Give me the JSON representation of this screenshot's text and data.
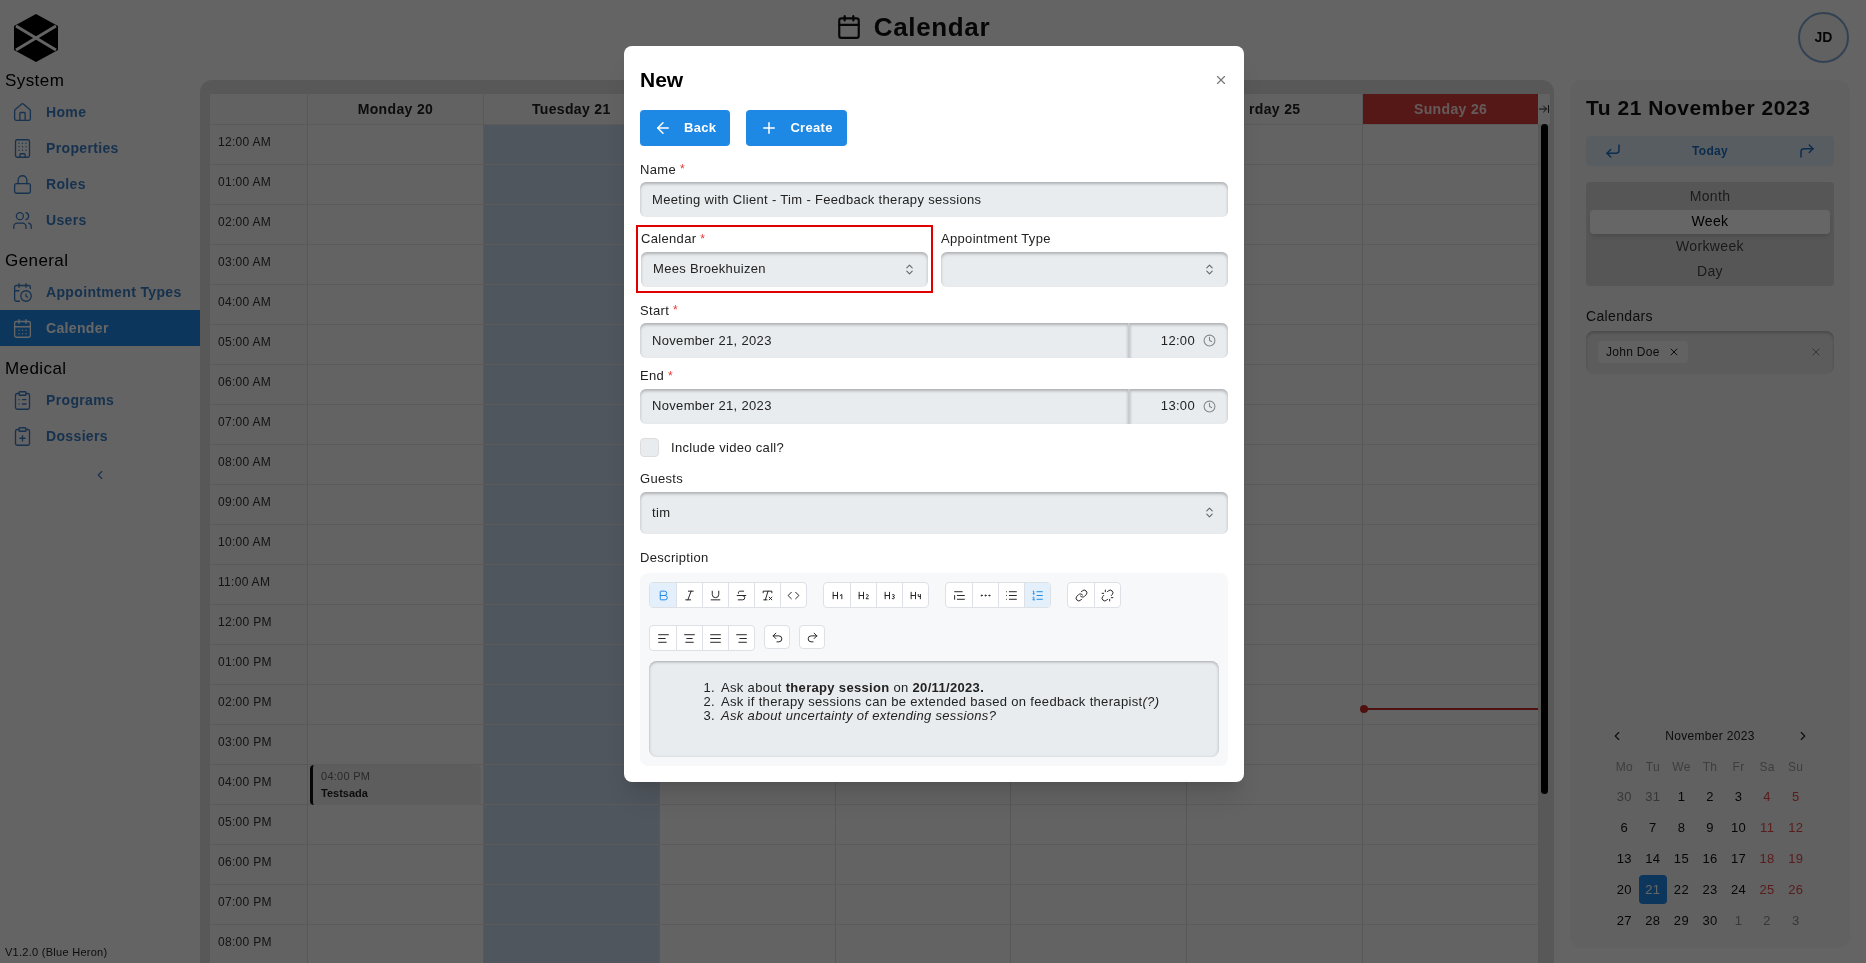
{
  "header": {
    "title": "Calendar",
    "avatar": "JD"
  },
  "sidebar": {
    "sections": [
      {
        "title": "System",
        "items": [
          {
            "label": "Home",
            "kind": "home",
            "selected": false
          },
          {
            "label": "Properties",
            "kind": "building",
            "selected": false
          },
          {
            "label": "Roles",
            "kind": "lock",
            "selected": false
          },
          {
            "label": "Users",
            "kind": "users",
            "selected": false
          }
        ]
      },
      {
        "title": "General",
        "items": [
          {
            "label": "Appointment Types",
            "kind": "calendar-clock",
            "selected": false
          },
          {
            "label": "Calender",
            "kind": "calendar",
            "selected": true
          }
        ]
      },
      {
        "title": "Medical",
        "items": [
          {
            "label": "Programs",
            "kind": "clipboard",
            "selected": false
          },
          {
            "label": "Dossiers",
            "kind": "clipboard-heart",
            "selected": false
          }
        ]
      }
    ],
    "version": "V1.2.0 (Blue Heron)"
  },
  "week": {
    "days": [
      {
        "label": "Monday 20",
        "today": false,
        "highlighted": false,
        "events": [
          {
            "time": "04:00 PM",
            "title": "Testsada"
          }
        ]
      },
      {
        "label": "Tuesday 21",
        "today": true,
        "highlighted": false
      },
      {
        "today": false
      },
      {
        "today": false
      },
      {
        "today": false
      },
      {
        "label": "rday 25",
        "today": false,
        "highlighted": false
      },
      {
        "label": "Sunday 26",
        "today": false,
        "highlighted": true
      }
    ],
    "hours": [
      "12:00 AM",
      "01:00 AM",
      "02:00 AM",
      "03:00 AM",
      "04:00 AM",
      "05:00 AM",
      "06:00 AM",
      "07:00 AM",
      "08:00 AM",
      "09:00 AM",
      "10:00 AM",
      "11:00 AM",
      "12:00 PM",
      "01:00 PM",
      "02:00 PM",
      "03:00 PM",
      "04:00 PM",
      "05:00 PM",
      "06:00 PM",
      "07:00 PM",
      "08:00 PM"
    ]
  },
  "right_panel": {
    "date_title": "Tu 21 November 2023",
    "today": "Today",
    "views": [
      {
        "label": "Month",
        "selected": false
      },
      {
        "label": "Week",
        "selected": true
      },
      {
        "label": "Workweek",
        "selected": false
      },
      {
        "label": "Day",
        "selected": false
      }
    ],
    "calendars_label": "Calendars",
    "chips": [
      "John Doe"
    ]
  },
  "mini_calendar": {
    "title": "November 2023",
    "weekdays": [
      "Mo",
      "Tu",
      "We",
      "Th",
      "Fr",
      "Sa",
      "Su"
    ],
    "weeks": [
      [
        {
          "label": "30",
          "outside": true,
          "weekend": false,
          "selected": false
        },
        {
          "label": "31",
          "outside": true,
          "weekend": false,
          "selected": false
        },
        {
          "label": "1",
          "outside": false,
          "weekend": false,
          "selected": false
        },
        {
          "label": "2",
          "outside": false,
          "weekend": false,
          "selected": false
        },
        {
          "label": "3",
          "outside": false,
          "weekend": false,
          "selected": false
        },
        {
          "label": "4",
          "outside": false,
          "weekend": true,
          "selected": false
        },
        {
          "label": "5",
          "outside": false,
          "weekend": true,
          "selected": false
        }
      ],
      [
        {
          "label": "6",
          "outside": false,
          "weekend": false,
          "selected": false
        },
        {
          "label": "7",
          "outside": false,
          "weekend": false,
          "selected": false
        },
        {
          "label": "8",
          "outside": false,
          "weekend": false,
          "selected": false
        },
        {
          "label": "9",
          "outside": false,
          "weekend": false,
          "selected": false
        },
        {
          "label": "10",
          "outside": false,
          "weekend": false,
          "selected": false
        },
        {
          "label": "11",
          "outside": false,
          "weekend": true,
          "selected": false
        },
        {
          "label": "12",
          "outside": false,
          "weekend": true,
          "selected": false
        }
      ],
      [
        {
          "label": "13",
          "outside": false,
          "weekend": false,
          "selected": false
        },
        {
          "label": "14",
          "outside": false,
          "weekend": false,
          "selected": false
        },
        {
          "label": "15",
          "outside": false,
          "weekend": false,
          "selected": false
        },
        {
          "label": "16",
          "outside": false,
          "weekend": false,
          "selected": false
        },
        {
          "label": "17",
          "outside": false,
          "weekend": false,
          "selected": false
        },
        {
          "label": "18",
          "outside": false,
          "weekend": true,
          "selected": false
        },
        {
          "label": "19",
          "outside": false,
          "weekend": true,
          "selected": false
        }
      ],
      [
        {
          "label": "20",
          "outside": false,
          "weekend": false,
          "selected": false
        },
        {
          "label": "21",
          "outside": false,
          "weekend": false,
          "selected": true
        },
        {
          "label": "22",
          "outside": false,
          "weekend": false,
          "selected": false
        },
        {
          "label": "23",
          "outside": false,
          "weekend": false,
          "selected": false
        },
        {
          "label": "24",
          "outside": false,
          "weekend": false,
          "selected": false
        },
        {
          "label": "25",
          "outside": false,
          "weekend": true,
          "selected": false
        },
        {
          "label": "26",
          "outside": false,
          "weekend": true,
          "selected": false
        }
      ],
      [
        {
          "label": "27",
          "outside": false,
          "weekend": false,
          "selected": false
        },
        {
          "label": "28",
          "outside": false,
          "weekend": false,
          "selected": false
        },
        {
          "label": "29",
          "outside": false,
          "weekend": false,
          "selected": false
        },
        {
          "label": "30",
          "outside": false,
          "weekend": false,
          "selected": false
        },
        {
          "label": "1",
          "outside": true,
          "weekend": false,
          "selected": false
        },
        {
          "label": "2",
          "outside": true,
          "weekend": false,
          "selected": false
        },
        {
          "label": "3",
          "outside": true,
          "weekend": false,
          "selected": false
        }
      ]
    ]
  },
  "modal": {
    "title": "New",
    "buttons": [
      {
        "label": "Back",
        "kind": "back"
      },
      {
        "label": "Create",
        "kind": "create"
      }
    ],
    "name": {
      "label": "Name",
      "required_mark": "*",
      "value": "Meeting with Client - Tim - Feedback therapy sessions"
    },
    "calendar": {
      "label": "Calendar",
      "required_mark": "*",
      "value": "Mees Broekhuizen",
      "error": true
    },
    "appointment_type": {
      "label": "Appointment Type"
    },
    "start": {
      "label": "Start",
      "required_mark": "*",
      "date": "November 21, 2023",
      "time": "12:00"
    },
    "end": {
      "label": "End",
      "required_mark": "*",
      "date": "November 21, 2023",
      "time": "13:00"
    },
    "video_call": {
      "label": "Include video call?",
      "checked": false
    },
    "guests": {
      "label": "Guests",
      "value": "tim"
    },
    "description": {
      "label": "Description",
      "toolbar": [
        [
          [
            {
              "kind": "bold",
              "active": true
            },
            {
              "kind": "italic",
              "active": false
            },
            {
              "kind": "underline",
              "active": false
            },
            {
              "kind": "strike",
              "active": false
            },
            {
              "kind": "clear",
              "active": false
            },
            {
              "kind": "code",
              "active": false
            }
          ],
          [
            {
              "kind": "h1",
              "active": false
            },
            {
              "kind": "h2",
              "active": false
            },
            {
              "kind": "h3",
              "active": false
            },
            {
              "kind": "h4",
              "active": false
            }
          ],
          [
            {
              "kind": "quote",
              "active": false
            },
            {
              "kind": "rule",
              "active": false
            },
            {
              "kind": "bullets",
              "active": false
            },
            {
              "kind": "numbers",
              "active": true
            }
          ],
          [
            {
              "kind": "link",
              "active": false
            },
            {
              "kind": "unlink",
              "active": false
            }
          ]
        ],
        [
          [
            {
              "kind": "align-left",
              "active": false
            },
            {
              "kind": "align-center",
              "active": false
            },
            {
              "kind": "align-justify",
              "active": false
            },
            {
              "kind": "align-right",
              "active": false
            }
          ],
          [
            {
              "kind": "undo",
              "active": false
            }
          ],
          [
            {
              "kind": "redo",
              "active": false
            }
          ]
        ]
      ],
      "items": [
        {
          "number": "1.",
          "parts": [
            {
              "text": "Ask about ",
              "kind": "plain"
            },
            {
              "text": "therapy session",
              "kind": "bold"
            },
            {
              "text": " on ",
              "kind": "plain"
            },
            {
              "text": "20/11/2023.",
              "kind": "bold"
            }
          ]
        },
        {
          "number": "2.",
          "parts": [
            {
              "text": "Ask if therapy sessions can be extended based on feedback therapist",
              "kind": "plain"
            },
            {
              "text": "(?)",
              "kind": "italic"
            }
          ]
        },
        {
          "number": "3.",
          "parts": [
            {
              "text": "Ask about uncertainty of extending sessions?",
              "kind": "italic"
            }
          ]
        }
      ]
    }
  }
}
